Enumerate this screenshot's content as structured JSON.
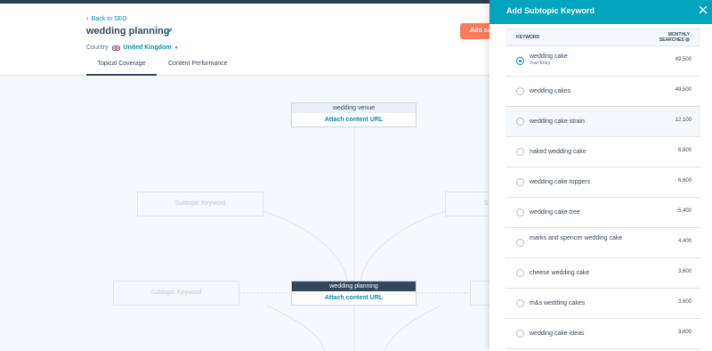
{
  "header": {
    "back_label": "Back to SEO",
    "title": "wedding planning",
    "country_label": "Country",
    "country_value": "United Kingdom",
    "add_button_label": "Add su",
    "tabs": [
      {
        "label": "Topical Coverage",
        "active": true
      },
      {
        "label": "Content Performance",
        "active": false
      }
    ]
  },
  "canvas": {
    "nodes": [
      {
        "title": "wedding venue",
        "link": "Attach content URL"
      },
      {
        "title": "wedding planning",
        "link": "Attach content URL"
      }
    ],
    "placeholders": [
      "Subtopic Keyword",
      "Subtopic Keyword",
      "S",
      ""
    ]
  },
  "panel": {
    "title": "Add Subtopic Keyword",
    "col_keyword": "KEYWORD",
    "col_searches_line1": "MONTHLY",
    "col_searches_line2": "SEARCHES",
    "rows": [
      {
        "keyword": "wedding cake",
        "sub": "Your Entry",
        "searches": "49,500",
        "selected": true
      },
      {
        "keyword": "wedding cakes",
        "searches": "49,500"
      },
      {
        "keyword": "wedding cake strain",
        "searches": "12,100"
      },
      {
        "keyword": "naked wedding cake",
        "searches": "6,600"
      },
      {
        "keyword": "wedding cake toppers",
        "searches": "6,600"
      },
      {
        "keyword": "wedding cake tree",
        "searches": "5,400"
      },
      {
        "keyword": "marks and spencer wedding cake",
        "searches": "4,400"
      },
      {
        "keyword": "cheese wedding cake",
        "searches": "3,600"
      },
      {
        "keyword": "m&s wedding cakes",
        "searches": "3,600"
      },
      {
        "keyword": "wedding cake ideas",
        "searches": "3,600"
      }
    ]
  },
  "colors": {
    "accent": "#00a4bd",
    "link": "#0091ae",
    "cta": "#ff7a59",
    "dark": "#33475b"
  }
}
